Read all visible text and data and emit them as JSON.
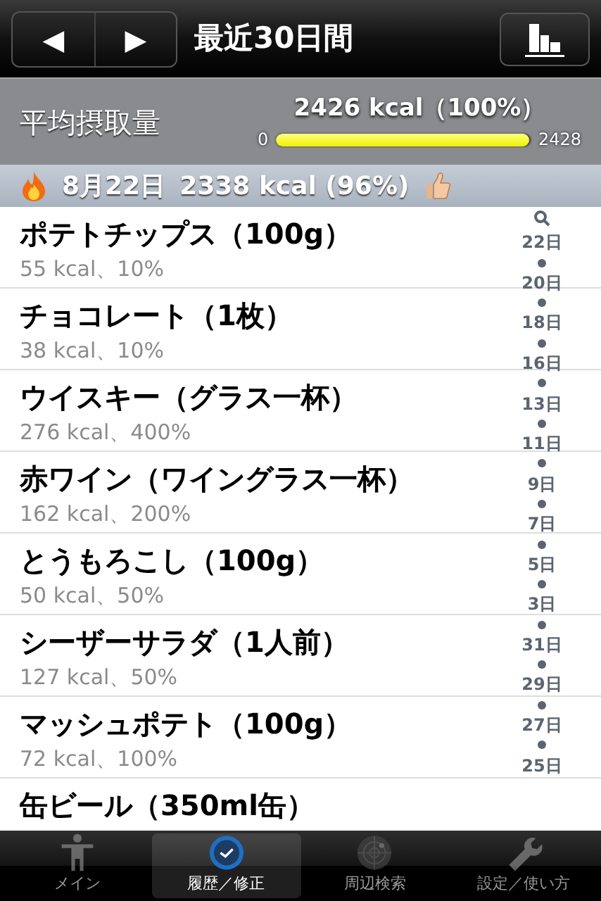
{
  "nav": {
    "prev": "◀",
    "next": "▶",
    "title": "最近30日間"
  },
  "summary": {
    "label": "平均摂取量",
    "value": "2426 kcal（100%）",
    "min": "0",
    "max": "2428",
    "level": 0.99
  },
  "day_header": {
    "date": "8月22日",
    "total": "2338 kcal (96%)"
  },
  "foods": [
    {
      "name": "ポテトチップス（100g）",
      "detail": "55 kcal、10%"
    },
    {
      "name": "チョコレート（1枚）",
      "detail": "38 kcal、10%"
    },
    {
      "name": "ウイスキー（グラス一杯）",
      "detail": "276 kcal、400%"
    },
    {
      "name": "赤ワイン（ワイングラス一杯）",
      "detail": "162 kcal、200%"
    },
    {
      "name": "とうもろこし（100g）",
      "detail": "50 kcal、50%"
    },
    {
      "name": "シーザーサラダ（1人前）",
      "detail": "127 kcal、50%"
    },
    {
      "name": "マッシュポテト（100g）",
      "detail": "72 kcal、100%"
    },
    {
      "name": "缶ビール（350ml缶）"
    }
  ],
  "index": [
    "22日",
    "20日",
    "18日",
    "16日",
    "13日",
    "11日",
    "9日",
    "7日",
    "5日",
    "3日",
    "31日",
    "29日",
    "27日",
    "25日"
  ],
  "tabs": [
    {
      "label": "メイン",
      "kind": "person",
      "selected": false
    },
    {
      "label": "履歴／修正",
      "kind": "clock",
      "selected": true
    },
    {
      "label": "周辺検索",
      "kind": "radar",
      "selected": false
    },
    {
      "label": "設定／使い方",
      "kind": "wrench",
      "selected": false
    }
  ]
}
